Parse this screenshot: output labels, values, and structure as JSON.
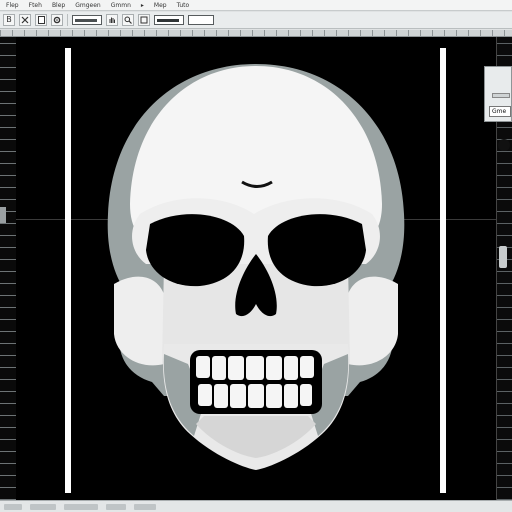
{
  "menubar": {
    "items": [
      "Flep",
      "Fteh",
      "Blep",
      "Gmgeen",
      "Gmmn",
      "▸",
      "Mep",
      "Tuto"
    ]
  },
  "toolbar": {
    "buttons": [
      "B",
      "/",
      "▭",
      "▭",
      "☐"
    ]
  },
  "float_panel": {
    "field_value": "Gme"
  },
  "icons": {
    "close": "close-icon",
    "page": "page-icon",
    "gear": "gear-icon",
    "hand": "hand-icon",
    "zoom": "zoom-icon"
  },
  "colors": {
    "canvas": "#000000",
    "chrome": "#e9eced",
    "skull_light": "#f5f5f5",
    "skull_shadow": "#9aa3a3"
  }
}
